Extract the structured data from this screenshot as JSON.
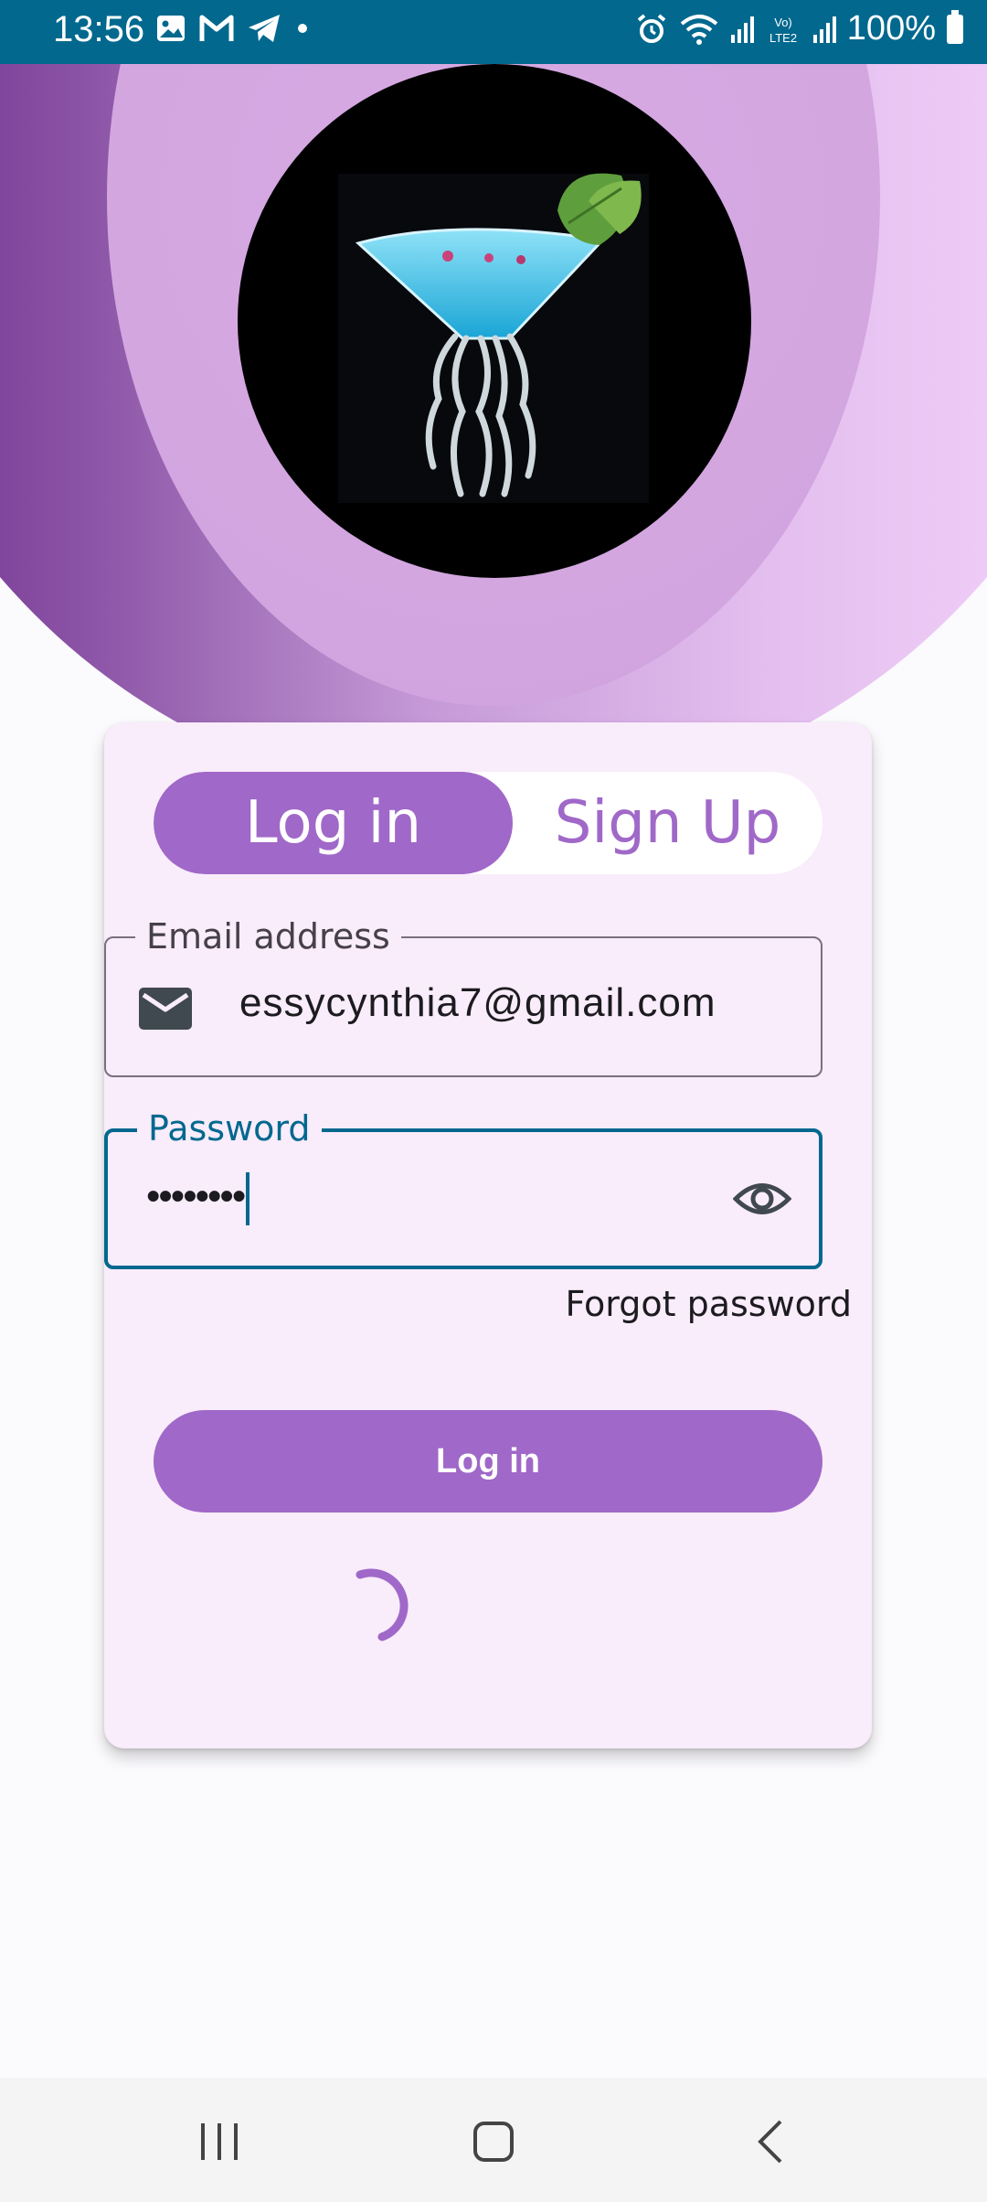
{
  "status_bar": {
    "time": "13:56",
    "battery": "100%",
    "left_icons": [
      "gallery-icon",
      "gmail-icon",
      "telegram-icon",
      "dot-icon"
    ],
    "right_icons": [
      "alarm-icon",
      "wifi-icon",
      "signal-icon",
      "volte-icon",
      "signal-icon",
      "battery-icon"
    ]
  },
  "auth_tabs": {
    "login": "Log in",
    "signup": "Sign Up",
    "active": "login"
  },
  "email": {
    "label": "Email address",
    "value": "essycynthia7@gmail.com",
    "icon": "mail-icon"
  },
  "password": {
    "label": "Password",
    "value": "••••••••",
    "icon": "eye-icon"
  },
  "forgot_label": "Forgot password",
  "login_button": "Log in",
  "colors": {
    "accent": "#a068c8",
    "status_bar": "#02688e",
    "card_bg": "#f9ecfb",
    "focus": "#02688e"
  },
  "nav": [
    "recents-icon",
    "home-icon",
    "back-icon"
  ]
}
